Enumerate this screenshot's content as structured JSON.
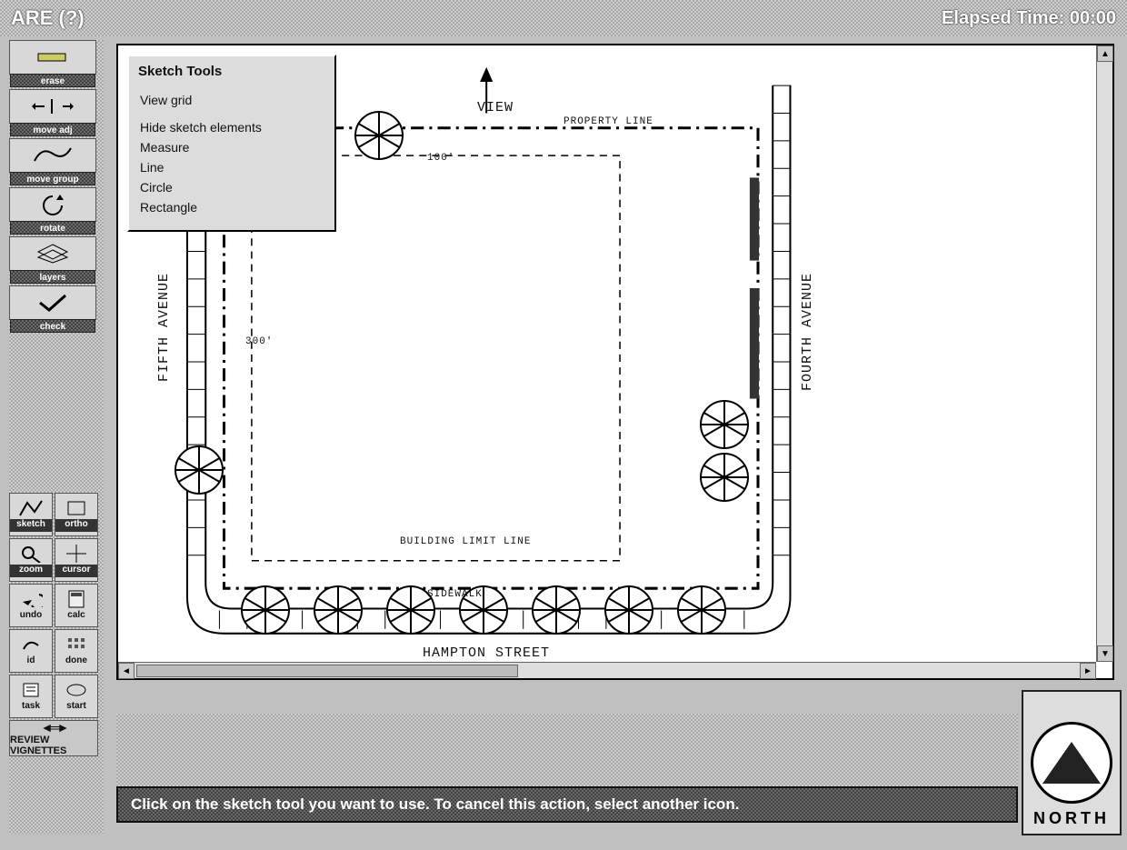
{
  "titlebar": {
    "left": "ARE (?)",
    "right": "Elapsed Time: 00:00"
  },
  "toolbar_main": [
    {
      "id": "erase",
      "label": "erase"
    },
    {
      "id": "move-adj",
      "label": "move adj"
    },
    {
      "id": "move-group",
      "label": "move group"
    },
    {
      "id": "rotate",
      "label": "rotate"
    },
    {
      "id": "layers",
      "label": "layers"
    },
    {
      "id": "check",
      "label": "check"
    }
  ],
  "toolbar_grid": [
    {
      "id": "sketch",
      "label": "sketch"
    },
    {
      "id": "ortho",
      "label": "ortho"
    },
    {
      "id": "zoom",
      "label": "zoom"
    },
    {
      "id": "cursor",
      "label": "cursor"
    },
    {
      "id": "undo",
      "label": "undo"
    },
    {
      "id": "calc",
      "label": "calc"
    },
    {
      "id": "id",
      "label": "id"
    },
    {
      "id": "done",
      "label": "done"
    },
    {
      "id": "task",
      "label": "task"
    },
    {
      "id": "start",
      "label": "start"
    }
  ],
  "review_button": "REVIEW VIGNETTES",
  "popup": {
    "title": "Sketch Tools",
    "items": [
      "View grid",
      "Hide sketch elements",
      "Measure",
      "Line",
      "Circle",
      "Rectangle"
    ]
  },
  "plan": {
    "view": "VIEW",
    "property_line": "PROPERTY LINE",
    "building_limit": "BUILDING LIMIT LINE",
    "sidewalk": "SIDEWALK",
    "dim_100": "100'",
    "dim_300": "300'",
    "street_south": "HAMPTON STREET",
    "avenue_left": "FIFTH AVENUE",
    "avenue_right": "FOURTH AVENUE"
  },
  "statusbar": "Click on the sketch tool you want to use.  To cancel this action, select another icon.",
  "compass": "NORTH"
}
